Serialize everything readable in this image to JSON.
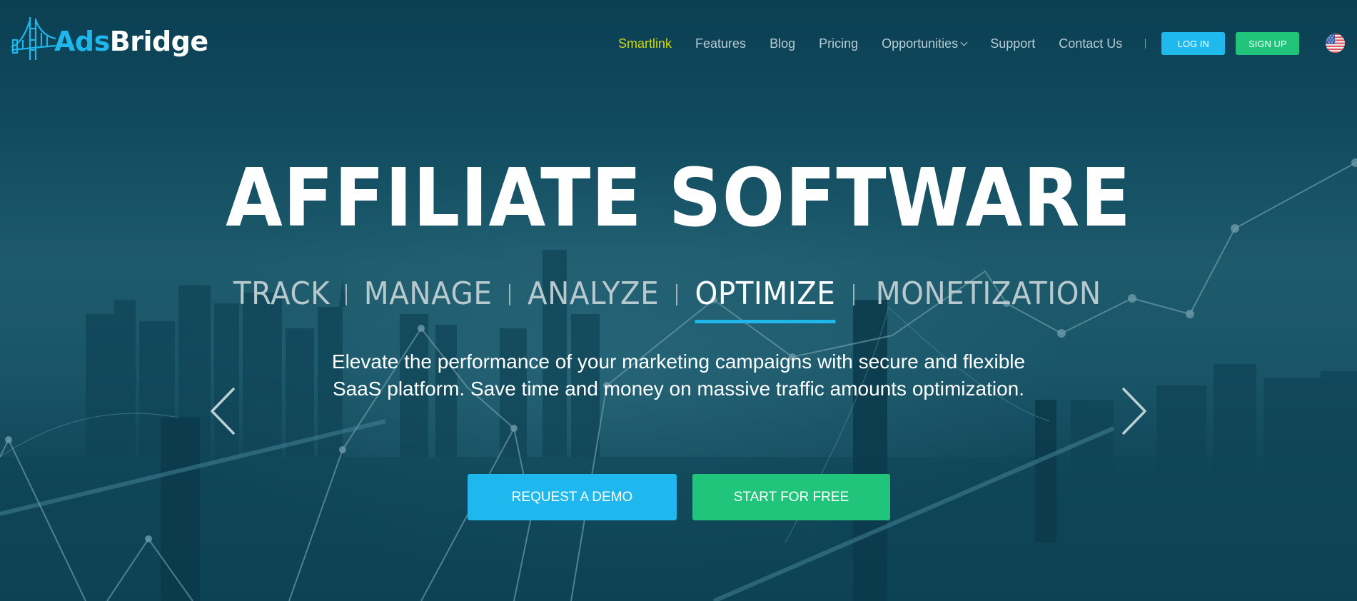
{
  "brand": {
    "name_part1": "Ads",
    "name_part2": "Bridge",
    "logo_icon": "bridge-icon",
    "accent": "#1fb6ec",
    "green": "#20c47a",
    "active_nav_color": "#d2d70f"
  },
  "nav": {
    "items": [
      {
        "label": "Smartlink",
        "active": true
      },
      {
        "label": "Features",
        "active": false
      },
      {
        "label": "Blog",
        "active": false
      },
      {
        "label": "Pricing",
        "active": false
      },
      {
        "label": "Opportunities",
        "active": false,
        "has_dropdown": true
      },
      {
        "label": "Support",
        "active": false
      },
      {
        "label": "Contact Us",
        "active": false
      }
    ],
    "login_label": "LOG IN",
    "signup_label": "SIGN UP",
    "language_icon": "us-flag-icon"
  },
  "hero": {
    "headline": "AFFILIATE SOFTWARE",
    "tags": [
      {
        "label": "TRACK",
        "active": false
      },
      {
        "label": "MANAGE",
        "active": false
      },
      {
        "label": "ANALYZE",
        "active": false
      },
      {
        "label": "OPTIMIZE",
        "active": true
      },
      {
        "label": "MONETIZATION",
        "active": false
      }
    ],
    "description_line1": "Elevate the performance of your marketing campaigns with secure and flexible",
    "description_line2": "SaaS platform. Save time and money on massive traffic amounts optimization.",
    "prev_icon": "chevron-left-icon",
    "next_icon": "chevron-right-icon",
    "cta_demo_label": "REQUEST A DEMO",
    "cta_free_label": "START FOR FREE"
  }
}
